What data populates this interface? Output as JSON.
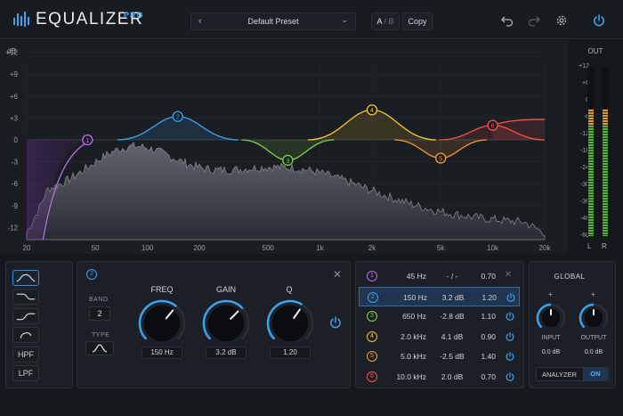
{
  "header": {
    "title": "EQUALIZER",
    "badge": "PRO",
    "preset_name": "Default Preset",
    "ab_a": "A",
    "ab_sep": "/",
    "ab_b": "B",
    "copy_label": "Copy"
  },
  "graph": {
    "db_unit": "dB",
    "db_ticks": [
      {
        "label": "+12",
        "db": 12
      },
      {
        "label": "+9",
        "db": 9
      },
      {
        "label": "+6",
        "db": 6
      },
      {
        "label": "+3",
        "db": 3
      },
      {
        "label": "0",
        "db": 0
      },
      {
        "label": "-3",
        "db": -3
      },
      {
        "label": "-6",
        "db": -6
      },
      {
        "label": "-9",
        "db": -9
      },
      {
        "label": "-12",
        "db": -12
      }
    ],
    "freq_ticks": [
      {
        "label": "20",
        "hz": 20
      },
      {
        "label": "50",
        "hz": 50
      },
      {
        "label": "100",
        "hz": 100
      },
      {
        "label": "200",
        "hz": 200
      },
      {
        "label": "500",
        "hz": 500
      },
      {
        "label": "1k",
        "hz": 1000
      },
      {
        "label": "2k",
        "hz": 2000
      },
      {
        "label": "5k",
        "hz": 5000
      },
      {
        "label": "10k",
        "hz": 10000
      },
      {
        "label": "20k",
        "hz": 20000
      }
    ],
    "nodes": [
      {
        "num": "1",
        "hz": 45,
        "db": 0,
        "color": "#b86bf0"
      },
      {
        "num": "2",
        "hz": 150,
        "db": 3.2,
        "color": "#3aa2ee"
      },
      {
        "num": "3",
        "hz": 650,
        "db": -2.8,
        "color": "#7fd14b"
      },
      {
        "num": "4",
        "hz": 2000,
        "db": 4.1,
        "color": "#f2c631"
      },
      {
        "num": "5",
        "hz": 5000,
        "db": -2.5,
        "color": "#f39a3a"
      },
      {
        "num": "6",
        "hz": 10000,
        "db": 2.0,
        "color": "#f2564e"
      }
    ]
  },
  "meter": {
    "title": "OUT",
    "ticks": [
      "+12",
      "+6",
      "0",
      "-6",
      "-12",
      "-18",
      "-24",
      "-30",
      "-36",
      "-48",
      "-60"
    ],
    "left_label": "L",
    "right_label": "R",
    "level_left": 0.75,
    "level_right": 0.75
  },
  "filter_types": {
    "items": [
      {
        "name": "filter-type-bell",
        "icon": "bell-curve-icon",
        "label": "",
        "active": true
      },
      {
        "name": "filter-type-high-shelf",
        "icon": "high-shelf-icon",
        "label": "",
        "active": false
      },
      {
        "name": "filter-type-low-shelf",
        "icon": "low-shelf-icon",
        "label": "",
        "active": false
      },
      {
        "name": "filter-type-notch",
        "icon": "notch-icon",
        "label": "",
        "active": false
      },
      {
        "name": "filter-type-hpf",
        "icon": "",
        "label": "HPF",
        "active": false
      },
      {
        "name": "filter-type-lpf",
        "icon": "",
        "label": "LPF",
        "active": false
      }
    ]
  },
  "band_editor": {
    "band_badge": "2",
    "band_label": "BAND",
    "band_value": "2",
    "type_label": "TYPE",
    "freq_label": "FREQ",
    "freq_value": "150 Hz",
    "gain_label": "GAIN",
    "gain_value": "3.2 dB",
    "q_label": "Q",
    "q_value": "1.20"
  },
  "band_list": {
    "rows": [
      {
        "num": "1",
        "freq": "45 Hz",
        "gain": "- / -",
        "q": "0.70",
        "color": "#b86bf0",
        "selected": false,
        "power": "x"
      },
      {
        "num": "2",
        "freq": "150 Hz",
        "gain": "3.2 dB",
        "q": "1.20",
        "color": "#3aa2ee",
        "selected": true,
        "power": "on"
      },
      {
        "num": "3",
        "freq": "650 Hz",
        "gain": "-2.8 dB",
        "q": "1.10",
        "color": "#7fd14b",
        "selected": false,
        "power": "on"
      },
      {
        "num": "4",
        "freq": "2.0 kHz",
        "gain": "4.1 dB",
        "q": "0.90",
        "color": "#f2c631",
        "selected": false,
        "power": "on"
      },
      {
        "num": "5",
        "freq": "5.0 kHz",
        "gain": "-2.5 dB",
        "q": "1.40",
        "color": "#f39a3a",
        "selected": false,
        "power": "on"
      },
      {
        "num": "6",
        "freq": "10.0 kHz",
        "gain": "2.0 dB",
        "q": "0.70",
        "color": "#f2564e",
        "selected": false,
        "power": "on"
      }
    ]
  },
  "global": {
    "title": "GLOBAL",
    "input_label": "INPUT",
    "input_value": "0.0 dB",
    "output_label": "OUTPUT",
    "output_value": "0.0 dB",
    "analyzer_label": "ANALYZER",
    "analyzer_state": "ON"
  },
  "colors": {
    "accent": "#3aa2ee",
    "background": "#15181d",
    "panel": "#1c2026"
  }
}
